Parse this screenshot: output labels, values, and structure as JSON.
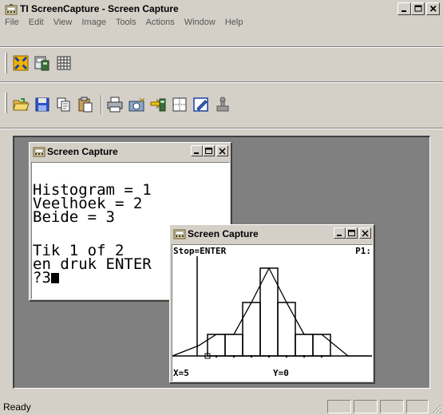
{
  "window": {
    "title": "TI ScreenCapture - Screen Capture",
    "minimize": "_",
    "maximize": "□",
    "close": "×"
  },
  "menu": [
    "File",
    "Edit",
    "View",
    "Image",
    "Tools",
    "Actions",
    "Window",
    "Help"
  ],
  "toolbar1": [
    "calculator-connect-icon",
    "handheld-icon",
    "grid-icon"
  ],
  "toolbar2": [
    "open-folder-icon",
    "save-icon",
    "copy-icon",
    "paste-icon",
    "print-icon",
    "camera-icon",
    "calc-send-icon",
    "border-icon",
    "edit-icon",
    "stamp-icon"
  ],
  "child1": {
    "title": "Screen Capture",
    "lines": [
      "Histogram = 1",
      "Veelhoek = 2",
      "Beide = 3",
      "",
      "Tik 1 of 2",
      "en druk ENTER",
      "?3"
    ]
  },
  "child2": {
    "title": "Screen Capture",
    "top_left": "Stop=ENTER",
    "top_right": "P1:",
    "bottom_left": "X=5",
    "bottom_mid": "Y=0"
  },
  "status": {
    "text": "Ready"
  }
}
